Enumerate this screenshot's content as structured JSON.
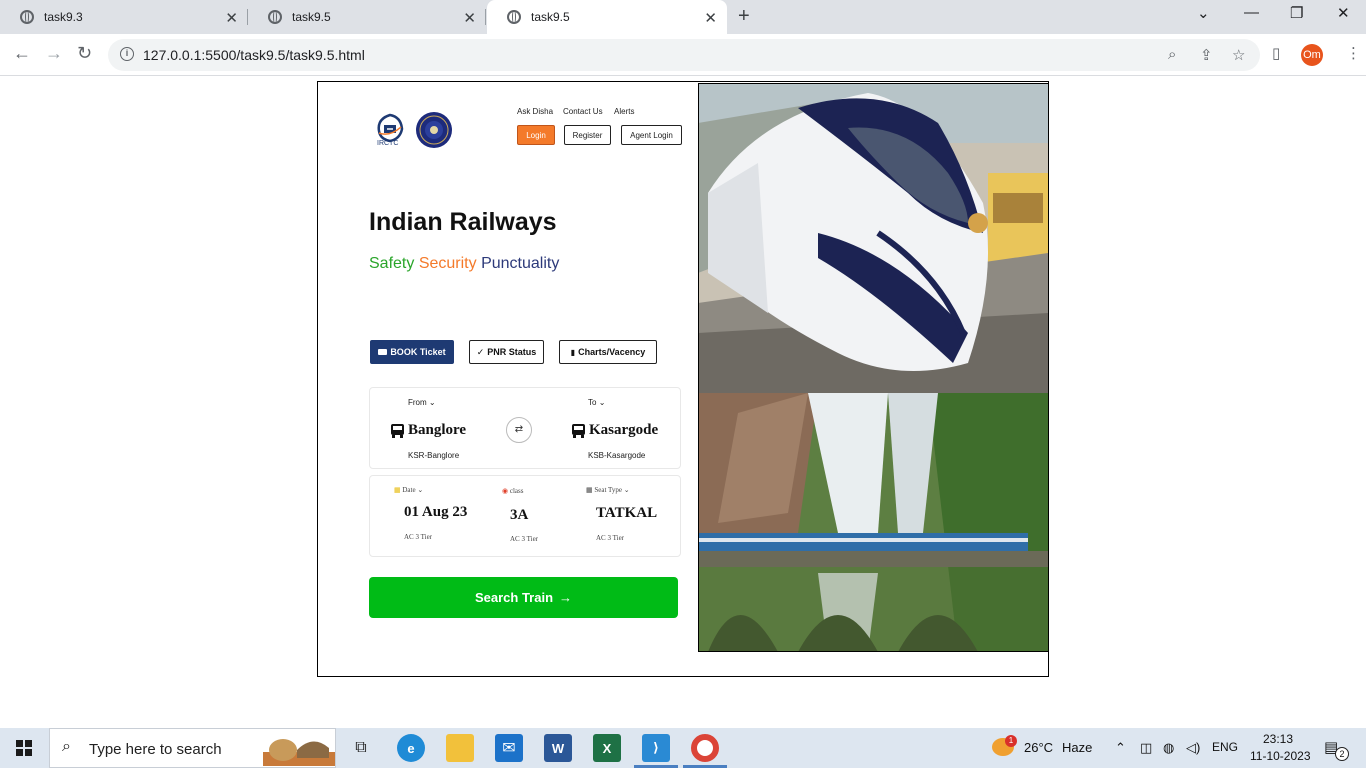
{
  "browser": {
    "tabs": [
      {
        "label": "task9.3",
        "active": false
      },
      {
        "label": "task9.5",
        "active": false
      },
      {
        "label": "task9.5",
        "active": true
      }
    ],
    "url": "127.0.0.1:5500/task9.5/task9.5.html",
    "profile_initials": "Om"
  },
  "header": {
    "irctc_logo_text": "IRCTC",
    "links": [
      "Ask Disha",
      "Contact Us",
      "Alerts"
    ],
    "buttons": {
      "login": "Login",
      "register": "Register",
      "agent_login": "Agent Login"
    }
  },
  "hero": {
    "title": "Indian Railways",
    "tagline": {
      "safety": "Safety",
      "security": "Security",
      "punctuality": "Punctuality"
    }
  },
  "modes": {
    "book": "BOOK Ticket",
    "pnr": "PNR Status",
    "charts": "Charts/Vacency"
  },
  "journey": {
    "from": {
      "label": "From",
      "city": "Banglore",
      "code": "KSR-Banglore"
    },
    "to": {
      "label": "To",
      "city": "Kasargode",
      "code": "KSB-Kasargode"
    }
  },
  "options": {
    "date": {
      "label": "Date",
      "value": "01 Aug 23",
      "sub": "AC 3 Tier"
    },
    "class": {
      "label": "class",
      "value": "3A",
      "sub": "AC 3 Tier"
    },
    "seat": {
      "label": "Seat Type",
      "value": "TATKAL",
      "sub": "AC 3 Tier"
    }
  },
  "search_button": "Search Train",
  "taskbar": {
    "search_placeholder": "Type here to search",
    "weather": "26°C",
    "weather_desc": "Haze",
    "weather_badge": "1",
    "lang": "ENG",
    "time": "23:13",
    "date": "11-10-2023",
    "notifications": "2"
  },
  "colors": {
    "accent_orange": "#f47a2a",
    "navy": "#1e3a73",
    "search_green": "#00bb16",
    "tag_green": "#2aa52a"
  }
}
